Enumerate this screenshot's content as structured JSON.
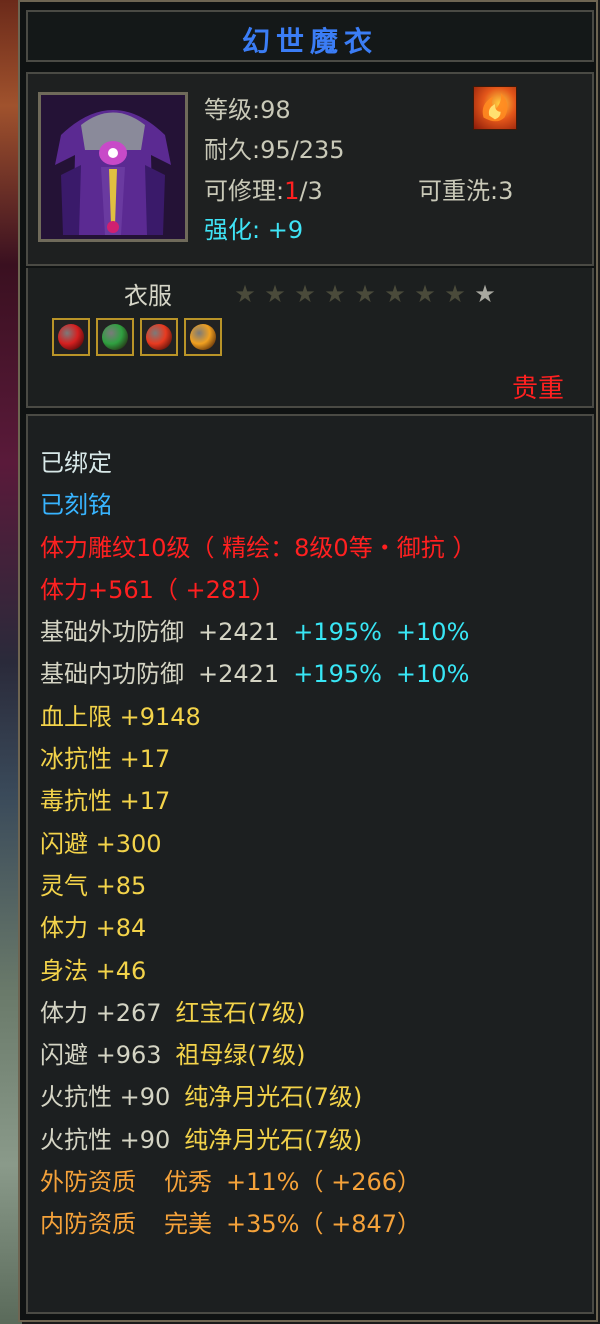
{
  "item": {
    "name": "幻世魔衣",
    "level_label": "等级:98",
    "durability_label": "耐久:95/235",
    "repair_prefix": "可修理:",
    "repair_used": "1",
    "repair_total": "/3",
    "rewash_label": "可重洗:3",
    "enhance_label": "强化: +9",
    "type_label": "衣服",
    "rarity_label": "贵重",
    "stars_total": 9,
    "stars_lit": 8
  },
  "colors": {
    "title": "#3b7df5",
    "rarity": "#ff2020",
    "enhance": "#3fe3f5"
  },
  "gems": [
    {
      "name": "ruby-gem-icon",
      "color": "#d52020"
    },
    {
      "name": "emerald-gem-icon",
      "color": "#2fa040"
    },
    {
      "name": "moonstone-gem-icon",
      "color": "#e83a20"
    },
    {
      "name": "moonstone-gem-icon",
      "color": "#f0a020"
    }
  ],
  "attributes": {
    "bound": "已绑定",
    "engraved": "已刻铭",
    "engrave_text": "体力雕纹10级（ 精绘：8级0等・御抗 ）",
    "vitality_main": "体力+561（ +281）",
    "outer_def_label": "基础外功防御",
    "outer_def_value": "+2421",
    "outer_def_pct1": "+195%",
    "outer_def_pct2": "+10%",
    "inner_def_label": "基础内功防御",
    "inner_def_value": "+2421",
    "inner_def_pct1": "+195%",
    "inner_def_pct2": "+10%",
    "hp": "血上限 +9148",
    "ice": "冰抗性 +17",
    "poison": "毒抗性 +17",
    "dodge": "闪避 +300",
    "spirit": "灵气 +85",
    "vit": "体力 +84",
    "agility": "身法 +46",
    "gem1_stat": "体力 +267",
    "gem1_name": "红宝石(7级)",
    "gem2_stat": "闪避 +963",
    "gem2_name": "祖母绿(7级)",
    "gem3_stat": "火抗性 +90",
    "gem3_name": "纯净月光石(7级)",
    "gem4_stat": "火抗性 +90",
    "gem4_name": "纯净月光石(7级)",
    "outer_quality_label": "外防资质",
    "outer_quality_grade": "优秀",
    "outer_quality_value": "+11%（ +266）",
    "inner_quality_label": "内防资质",
    "inner_quality_grade": "完美",
    "inner_quality_value": "+35%（ +847）"
  }
}
